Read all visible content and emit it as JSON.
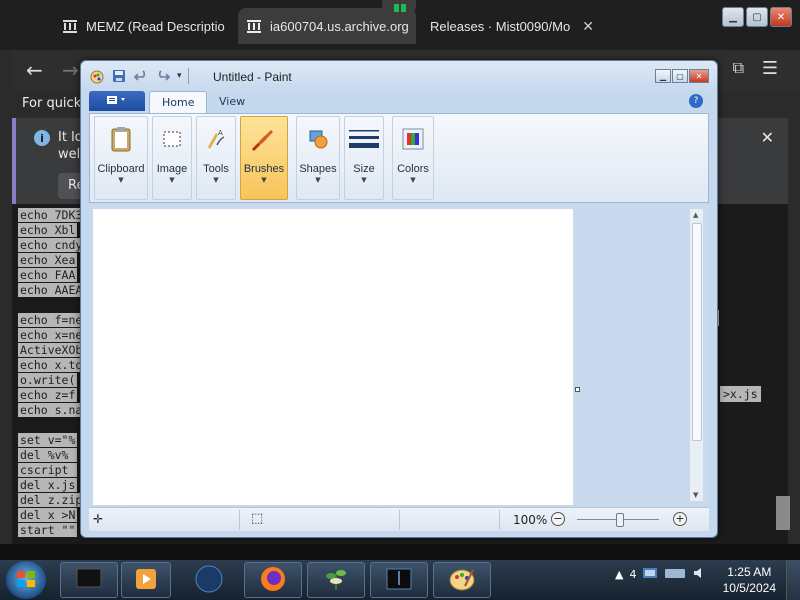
{
  "browser": {
    "tabs": [
      {
        "title": "MEMZ (Read Descriptio",
        "active": false
      },
      {
        "title": "ia600704.us.archive.org",
        "active": true
      },
      {
        "title": "Releases · Mist0090/Mo",
        "active": false
      }
    ],
    "quick_access_text": "For quick a",
    "info_bar": {
      "line1": "It loo",
      "line2": "welc",
      "button": "Re"
    }
  },
  "code_lines": [
    "echo 7DK3",
    "echo Xbl",
    "echo cndy",
    "echo Xea",
    "echo FAA",
    "echo AAEA",
    "echo f=ne",
    "echo x=ne",
    "ActiveXOb",
    "echo x.to",
    "o.write(",
    "echo z=f",
    "echo s.na",
    "set v=\"%",
    "del %v% ",
    "cscript ",
    "del x.js",
    "del z.zip",
    "del x >N",
    "start \"\""
  ],
  "code_fragment": ">x.js",
  "paint": {
    "title": "Untitled - Paint",
    "file_button": "",
    "tabs": [
      "Home",
      "View"
    ],
    "groups": [
      {
        "label": "Clipboard",
        "icon": "clipboard-icon",
        "active": false
      },
      {
        "label": "Image",
        "icon": "image-select-icon",
        "active": false
      },
      {
        "label": "Tools",
        "icon": "tools-icon",
        "active": false
      },
      {
        "label": "Brushes",
        "icon": "brush-icon",
        "active": true
      },
      {
        "label": "Shapes",
        "icon": "shapes-icon",
        "active": false
      },
      {
        "label": "Size",
        "icon": "size-icon",
        "active": false
      },
      {
        "label": "Colors",
        "icon": "colors-icon",
        "active": false
      }
    ],
    "zoom_level": "100%",
    "zoom_fraction": 0.52
  },
  "taskbar": {
    "time": "1:25 AM",
    "date": "10/5/2024",
    "tray_text": "4"
  }
}
